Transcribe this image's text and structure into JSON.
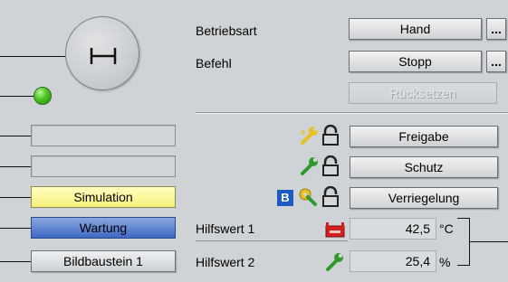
{
  "left": {
    "fields": [
      "",
      "",
      "Simulation",
      "Wartung",
      "Bildbaustein 1"
    ]
  },
  "main": {
    "betriebsart_label": "Betriebsart",
    "befehl_label": "Befehl",
    "betriebsart_value": "Hand",
    "befehl_value": "Stopp",
    "more_label": "...",
    "reset_label": "Rücksetzen",
    "freigabe_label": "Freigabe",
    "schutz_label": "Schutz",
    "verriegelung_label": "Verriegelung",
    "lock_b_label": "B",
    "hilfswert1_label": "Hilfswert 1",
    "hilfswert1_value": "42,5",
    "hilfswert1_unit": "°C",
    "hilfswert2_label": "Hilfswert 2",
    "hilfswert2_value": "25,4",
    "hilfswert2_unit": "%"
  },
  "colors": {
    "led": "#4ac21f",
    "simulation": "#f6f07a",
    "wartung": "#3f68c4"
  }
}
